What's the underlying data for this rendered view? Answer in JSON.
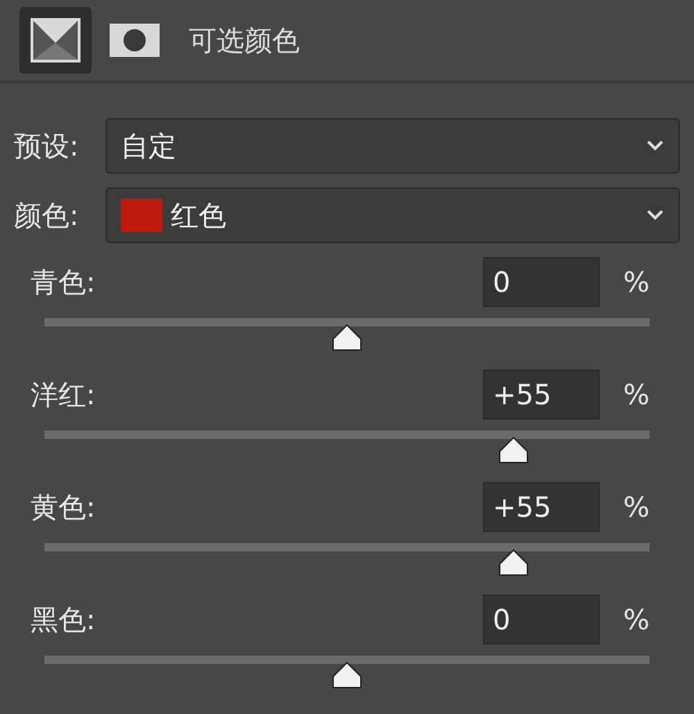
{
  "header": {
    "mode_buttons": [
      {
        "selected": true
      },
      {
        "selected": false
      }
    ],
    "title": "可选颜色"
  },
  "preset": {
    "label": "预设:",
    "value": "自定"
  },
  "color_select": {
    "label": "颜色:",
    "value": "红色",
    "color": "#c0170f"
  },
  "sliders": [
    {
      "label": "青色:",
      "value": "0",
      "unit": "%",
      "level": 0.5
    },
    {
      "label": "洋红:",
      "value": "+55",
      "unit": "%",
      "level": 0.775
    },
    {
      "label": "黄色:",
      "value": "+55",
      "unit": "%",
      "level": 0.775
    },
    {
      "label": "黑色:",
      "value": "0",
      "unit": "%",
      "level": 0.5
    }
  ]
}
